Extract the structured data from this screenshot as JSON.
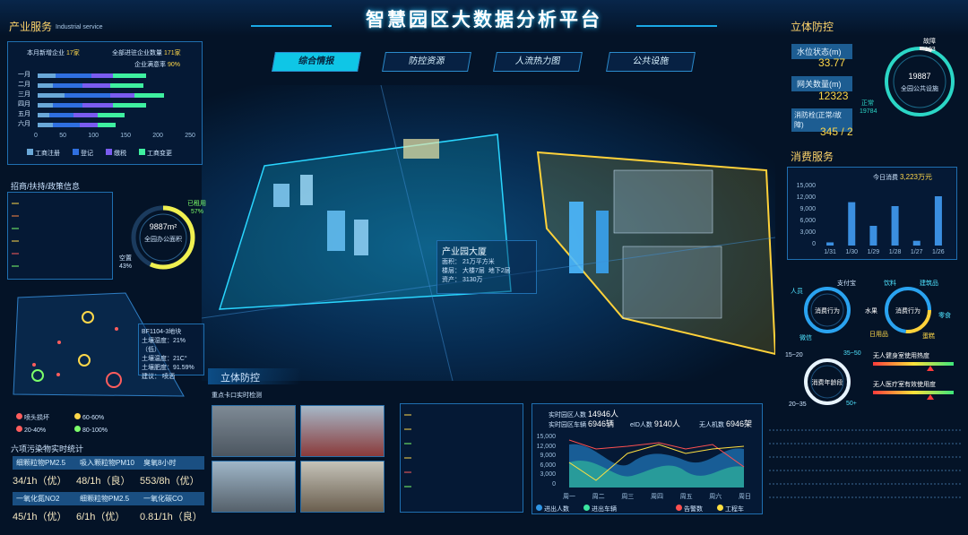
{
  "title": "智慧园区大数据分析平台",
  "nav": {
    "tabs": [
      "综合情报",
      "防控资源",
      "人流热力图",
      "公共设施"
    ]
  },
  "industry": {
    "title": "产业服务",
    "subtitle": "Industrial service",
    "new_enterprises_label": "本月新增企业",
    "new_enterprises_value": "17家",
    "total_enterprises_label": "全部进驻企业数量",
    "total_enterprises_value": "171家",
    "satisfaction_label": "企业满意率",
    "satisfaction_value": "90%",
    "months": [
      "一月",
      "二月",
      "三月",
      "四月",
      "五月",
      "六月"
    ],
    "axis": [
      "0",
      "50",
      "100",
      "150",
      "200",
      "250"
    ],
    "legend": [
      "工商注册",
      "登记",
      "缴税",
      "工商变更"
    ]
  },
  "chart_data": {
    "type": "bar",
    "orientation": "horizontal",
    "stacked": true,
    "categories": [
      "一月",
      "二月",
      "三月",
      "四月",
      "五月",
      "六月"
    ],
    "series": [
      {
        "name": "工商注册",
        "values": [
          30,
          25,
          45,
          25,
          20,
          25
        ]
      },
      {
        "name": "登记",
        "values": [
          60,
          50,
          75,
          50,
          40,
          45
        ]
      },
      {
        "name": "缴税",
        "values": [
          35,
          45,
          40,
          50,
          40,
          30
        ]
      },
      {
        "name": "工商变更",
        "values": [
          55,
          55,
          50,
          55,
          45,
          30
        ]
      }
    ],
    "xlim": [
      0,
      250
    ]
  },
  "investment": {
    "title": "招商/扶持/政策信息"
  },
  "office": {
    "value": "9887m²",
    "label": "全园办公面积",
    "used_label": "已租用",
    "used_value": "57%",
    "free_label": "空置",
    "free_value": "43%"
  },
  "plot": {
    "name": "BF1104-3地块",
    "humidity": "土壤湿度：21%（低）",
    "temp": "土壤温度：21C°",
    "fert": "土壤肥度：91.59%",
    "advice": "建议：    喷洒"
  },
  "sprinkler": {
    "legend": [
      "喷头损坏",
      "60-60%",
      "20-40%",
      "80-100%"
    ]
  },
  "air": {
    "title": "六项污染物实时统计",
    "items": [
      {
        "label": "细颗粒物PM2.5",
        "value": "34/1h（优）"
      },
      {
        "label": "吸入颗粒物PM10",
        "value": "48/1h（良）"
      },
      {
        "label": "臭氧8小时",
        "value": "553/8h（优）"
      },
      {
        "label": "一氧化氮NO2",
        "value": "45/1h（优）"
      },
      {
        "label": "细颗粒物PM2.5",
        "value": "6/1h（优）"
      },
      {
        "label": "一氧化碳CO",
        "value": "0.81/1h（良）"
      }
    ]
  },
  "building": {
    "name": "产业园大厦",
    "area": "面积：  21万平方米",
    "floors": "楼层：  大楼7层",
    "underground": "地下2层",
    "assets": "资产：  3130万"
  },
  "defense_bottom": {
    "title": "立体防控",
    "subtitle": "重点卡口实时检测"
  },
  "people": {
    "visitors_label": "实时园区人数",
    "visitors_value": "14946人",
    "vehicles_label": "实时园区车辆",
    "vehicles_value": "6946辆",
    "eid_label": "eID人数",
    "eid_value": "9140人",
    "drone_label": "无人机数",
    "drone_value": "6946架",
    "y_axis": [
      "15,000",
      "12,000",
      "9,000",
      "6,000",
      "3,000",
      "0"
    ],
    "days": [
      "周一",
      "周二",
      "周三",
      "周四",
      "周五",
      "周六",
      "周日"
    ],
    "legend": [
      "进出人数",
      "进出车辆",
      "告警数",
      "工程车"
    ]
  },
  "defense_right": {
    "title": "立体防控",
    "water_label": "水位状态(m)",
    "water_value": "33.77",
    "net_label": "网关数量(m)",
    "net_value": "12323",
    "hydrant_label": "消防栓(正常/故障)",
    "hydrant_value": "345 / 2",
    "ring_value": "19887",
    "ring_label": "全园公共设施",
    "fault_label": "故障",
    "fault_value": "103",
    "normal_label": "正常",
    "normal_value": "19784"
  },
  "consume": {
    "title": "消费服务",
    "today_label": "今日消费",
    "today_value": "3,223万元",
    "y_axis": [
      "15,000",
      "12,000",
      "9,000",
      "6,000",
      "3,000",
      "0"
    ],
    "dates": [
      "1/31",
      "1/30",
      "1/29",
      "1/28",
      "1/27",
      "1/26"
    ],
    "bars": [
      800,
      11000,
      5000,
      10000,
      1200,
      12500
    ],
    "behavior1": {
      "center": "消费行为",
      "tags": [
        "人员",
        "支付宝",
        "微信"
      ]
    },
    "behavior2": {
      "center": "消费行为",
      "tags": [
        "饮料",
        "建筑品",
        "水果",
        "零食",
        "日用品",
        "蛋糕"
      ]
    },
    "age": {
      "center": "消费年龄段",
      "tags": [
        "15~20",
        "35~50",
        "20~35",
        "50+"
      ]
    },
    "gym_label": "无人健身室使用热度",
    "clinic_label": "无人医疗室有效使用度"
  }
}
